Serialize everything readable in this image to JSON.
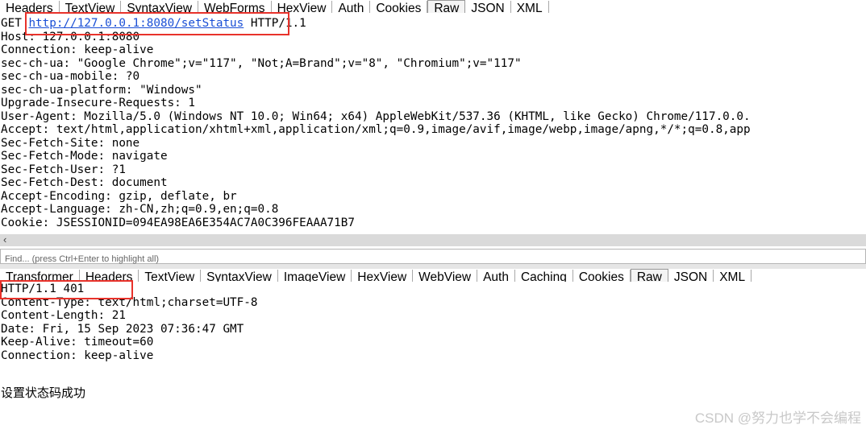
{
  "request_tabs": [
    "Headers",
    "TextView",
    "SyntaxView",
    "WebForms",
    "HexView",
    "Auth",
    "Cookies",
    "Raw",
    "JSON",
    "XML"
  ],
  "request_active_tab": "Raw",
  "request": {
    "method": "GET",
    "url": "http://127.0.0.1:8080/setStatus",
    "protocol": "HTTP/1.1",
    "headers": [
      "Host: 127.0.0.1:8080",
      "Connection: keep-alive",
      "sec-ch-ua: \"Google Chrome\";v=\"117\", \"Not;A=Brand\";v=\"8\", \"Chromium\";v=\"117\"",
      "sec-ch-ua-mobile: ?0",
      "sec-ch-ua-platform: \"Windows\"",
      "Upgrade-Insecure-Requests: 1",
      "User-Agent: Mozilla/5.0 (Windows NT 10.0; Win64; x64) AppleWebKit/537.36 (KHTML, like Gecko) Chrome/117.0.0.",
      "Accept: text/html,application/xhtml+xml,application/xml;q=0.9,image/avif,image/webp,image/apng,*/*;q=0.8,app",
      "Sec-Fetch-Site: none",
      "Sec-Fetch-Mode: navigate",
      "Sec-Fetch-User: ?1",
      "Sec-Fetch-Dest: document",
      "Accept-Encoding: gzip, deflate, br",
      "Accept-Language: zh-CN,zh;q=0.9,en;q=0.8",
      "Cookie: JSESSIONID=094EA98EA6E354AC7A0C396FEAAA71B7"
    ]
  },
  "scroll_left_glyph": "‹",
  "find": {
    "placeholder": "Find... (press Ctrl+Enter to highlight all)"
  },
  "response_tabs": [
    "Transformer",
    "Headers",
    "TextView",
    "SyntaxView",
    "ImageView",
    "HexView",
    "WebView",
    "Auth",
    "Caching",
    "Cookies",
    "Raw",
    "JSON",
    "XML"
  ],
  "response_active_tab": "Raw",
  "response": {
    "status_line": "HTTP/1.1 401",
    "headers": [
      "Content-Type: text/html;charset=UTF-8",
      "Content-Length: 21",
      "Date: Fri, 15 Sep 2023 07:36:47 GMT",
      "Keep-Alive: timeout=60",
      "Connection: keep-alive"
    ],
    "body": "设置状态码成功"
  },
  "watermark": "CSDN @努力也学不会编程",
  "highlight_color": "#e8322b",
  "link_color": "#1a4fd6"
}
